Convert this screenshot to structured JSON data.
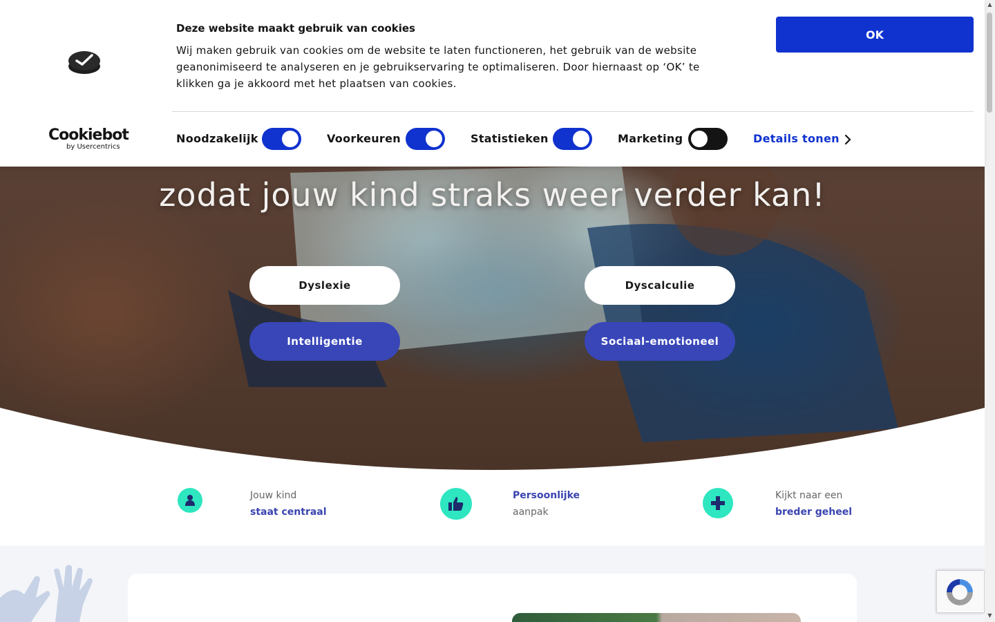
{
  "cookie_banner": {
    "title": "Deze website maakt gebruik van cookies",
    "text": "Wij maken gebruik van cookies om de website te laten functioneren, het gebruik van de website geanonimiseerd te analyseren en je gebruikservaring te optimaliseren. Door hiernaast op ‘OK’ te klikken ga je akkoord met het plaatsen van cookies.",
    "ok_label": "OK",
    "toggles": [
      {
        "label": "Noodzakelijk",
        "on": true
      },
      {
        "label": "Voorkeuren",
        "on": true
      },
      {
        "label": "Statistieken",
        "on": true
      },
      {
        "label": "Marketing",
        "on": false
      }
    ],
    "details_label": "Details tonen",
    "cookiebot_brand": "Cookiebot",
    "cookiebot_sub": "by Usercentrics"
  },
  "hero": {
    "headline_line2": "zodat jouw kind straks weer verder kan!",
    "buttons": [
      "Dyslexie",
      "Dyscalculie",
      "Intelligentie",
      "Sociaal-emotioneel"
    ]
  },
  "features": [
    {
      "icon": "user-icon",
      "line1": "Jouw kind",
      "line2": "staat centraal"
    },
    {
      "icon": "thumbs-up-icon",
      "line1": "Persoonlijke",
      "line2": "aanpak"
    },
    {
      "icon": "plus-icon",
      "line1": "Kijkt naar een",
      "line2": "breder geheel"
    }
  ],
  "colors": {
    "accent_blue": "#1032cf",
    "button_blue": "#3846b8",
    "feature_green": "#2ee6c0",
    "feature_text_blue": "#3a44b0"
  }
}
